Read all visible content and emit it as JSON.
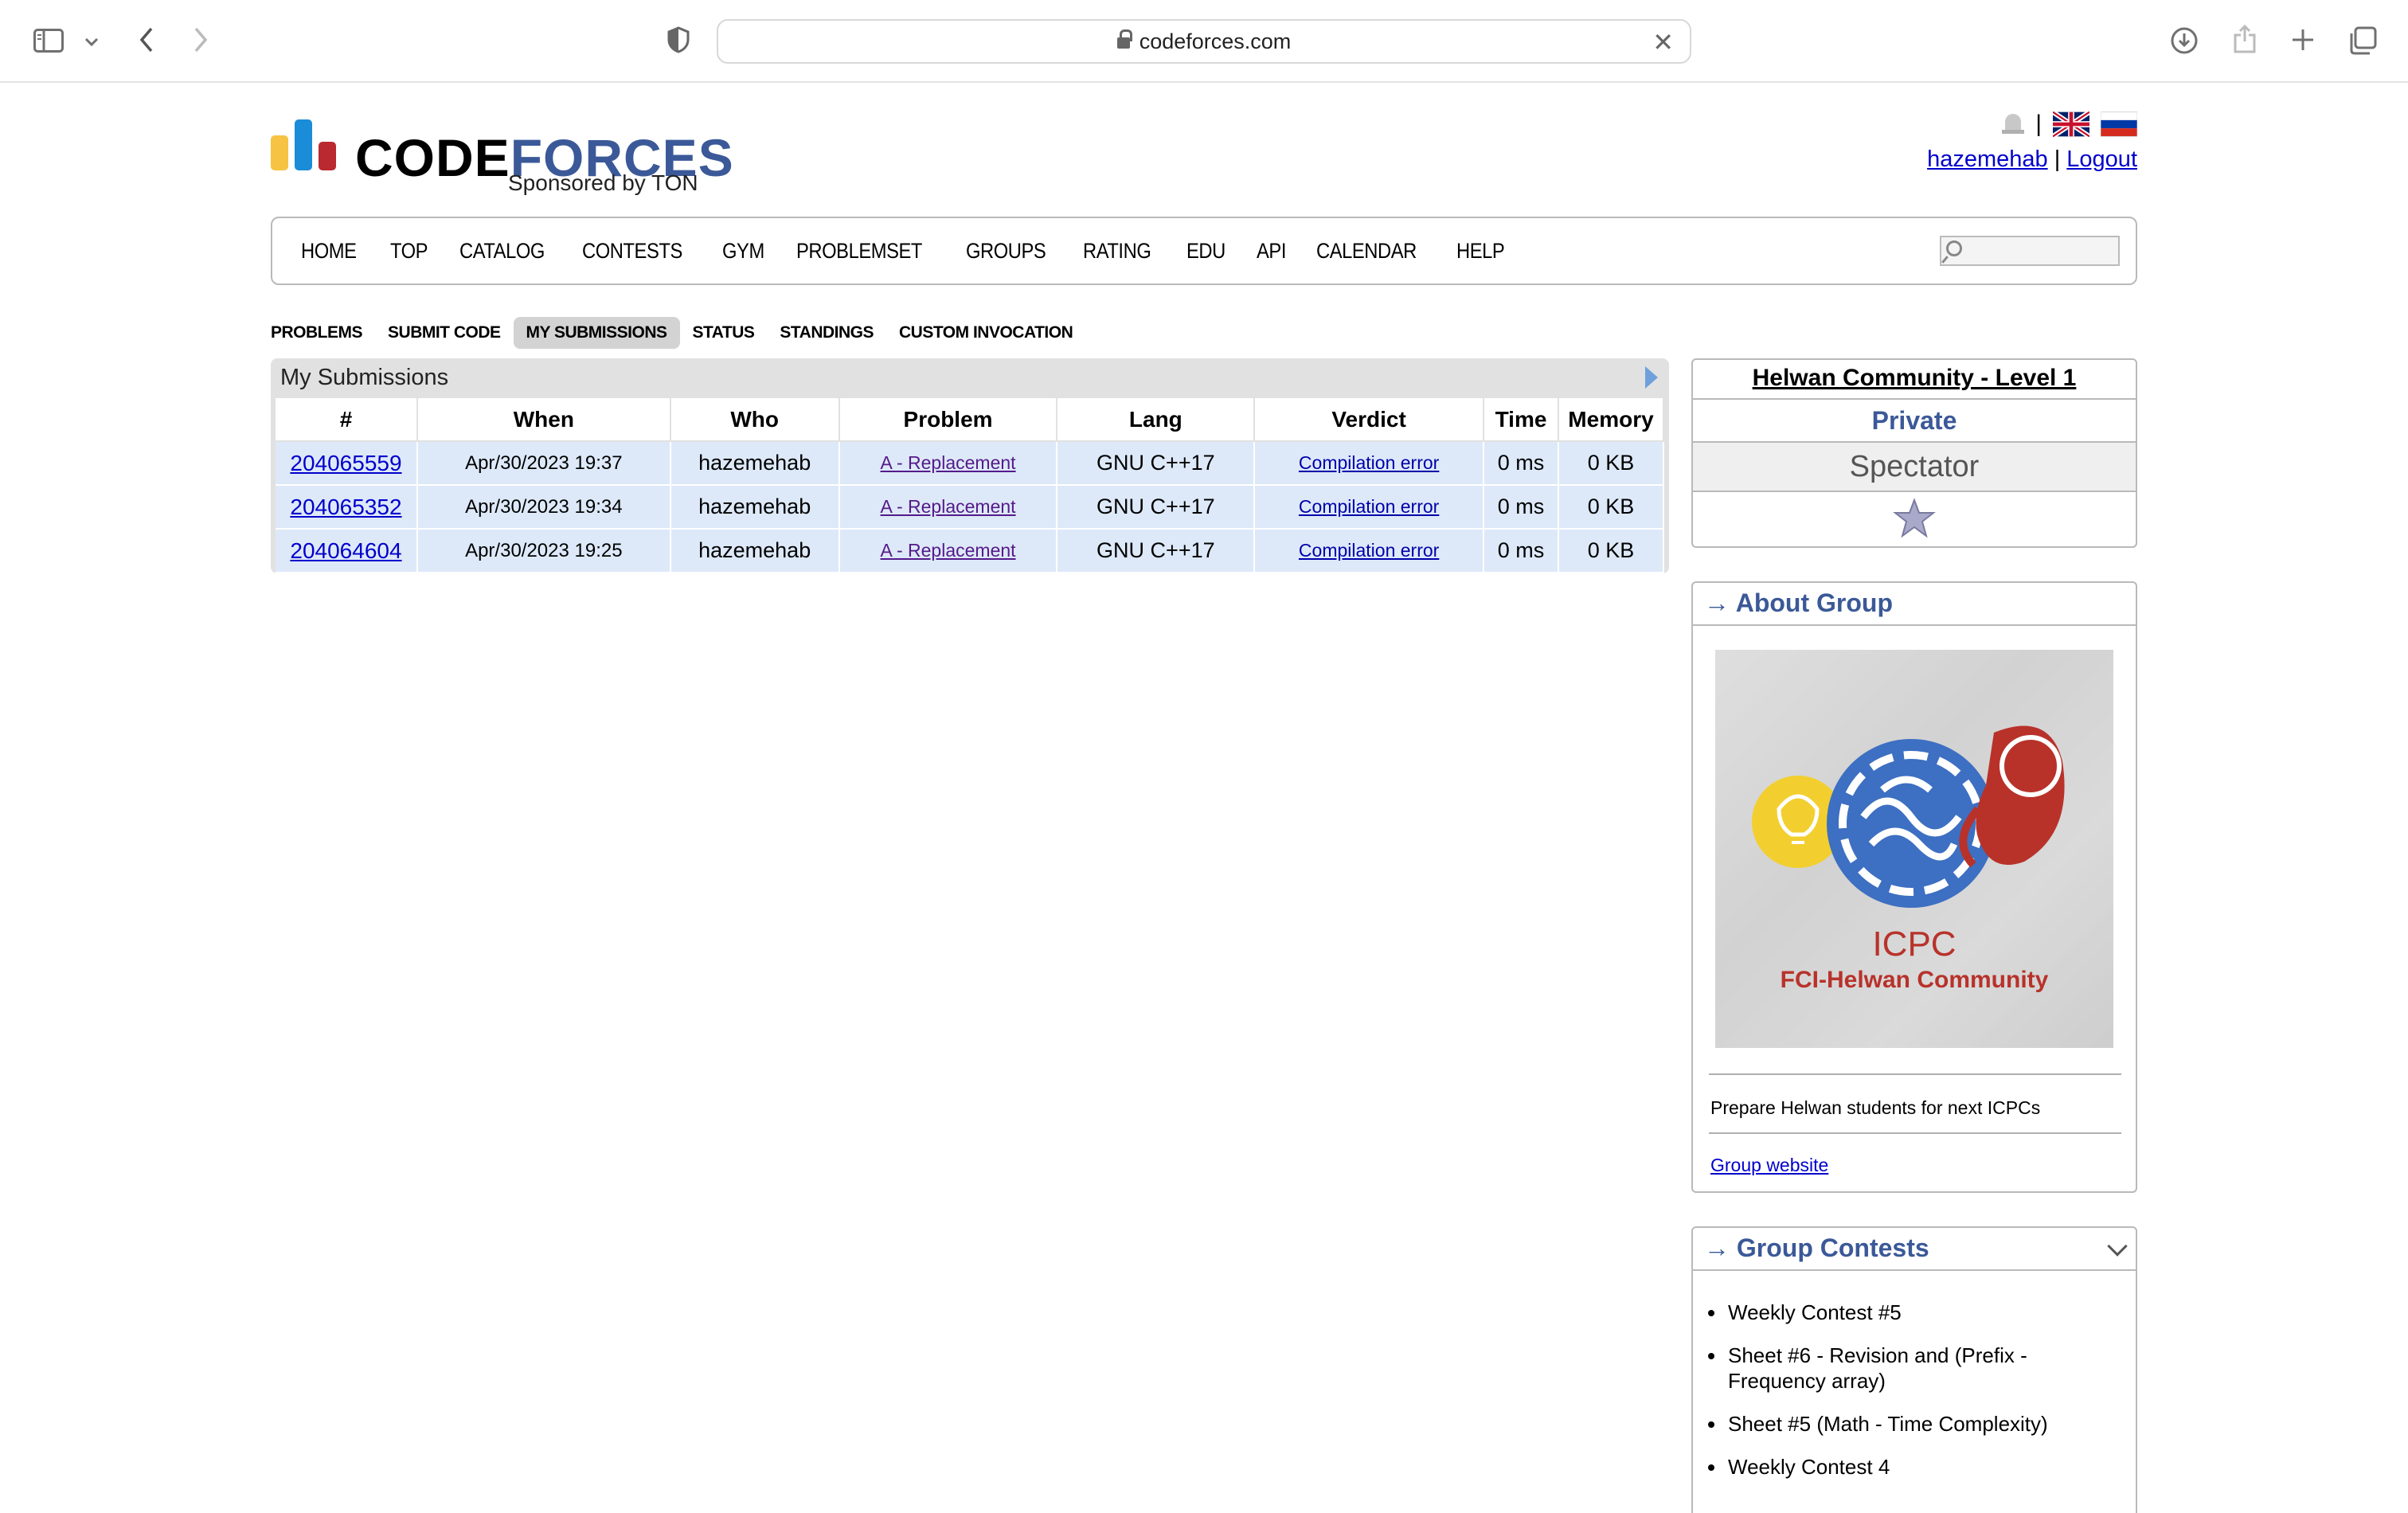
{
  "browser": {
    "url": "codeforces.com"
  },
  "header": {
    "logo_code": "CODE",
    "logo_forces": "FORCES",
    "sponsor": "Sponsored by TON",
    "username": "hazemehab",
    "logout": "Logout",
    "separator": "|"
  },
  "menu": {
    "items": [
      "HOME",
      "TOP",
      "CATALOG",
      "CONTESTS",
      "GYM",
      "PROBLEMSET",
      "GROUPS",
      "RATING",
      "EDU",
      "API",
      "CALENDAR",
      "HELP"
    ]
  },
  "submenu": {
    "items": [
      "PROBLEMS",
      "SUBMIT CODE",
      "MY SUBMISSIONS",
      "STATUS",
      "STANDINGS",
      "CUSTOM INVOCATION"
    ],
    "active": "MY SUBMISSIONS"
  },
  "submissions": {
    "title": "My Submissions",
    "headers": [
      "#",
      "When",
      "Who",
      "Problem",
      "Lang",
      "Verdict",
      "Time",
      "Memory"
    ],
    "rows": [
      {
        "id": "204065559",
        "when": "Apr/30/2023 19:37",
        "who": "hazemehab",
        "problem": "A - Replacement",
        "lang": "GNU C++17",
        "verdict": "Compilation error",
        "time": "0 ms",
        "memory": "0 KB"
      },
      {
        "id": "204065352",
        "when": "Apr/30/2023 19:34",
        "who": "hazemehab",
        "problem": "A - Replacement",
        "lang": "GNU C++17",
        "verdict": "Compilation error",
        "time": "0 ms",
        "memory": "0 KB"
      },
      {
        "id": "204064604",
        "when": "Apr/30/2023 19:25",
        "who": "hazemehab",
        "problem": "A - Replacement",
        "lang": "GNU C++17",
        "verdict": "Compilation error",
        "time": "0 ms",
        "memory": "0 KB"
      }
    ]
  },
  "group": {
    "name": "Helwan Community - Level 1",
    "privacy": "Private",
    "role": "Spectator"
  },
  "about": {
    "caption": "→ About Group",
    "logo_line1": "ICPC",
    "logo_line2": "FCI-Helwan Community",
    "description": "Prepare Helwan students for next ICPCs",
    "website": "Group website"
  },
  "contests": {
    "caption": "→ Group Contests",
    "items": [
      "Weekly Contest #5",
      "Sheet #6 - Revision and (Prefix - Frequency array)",
      "Sheet #5 (Math - Time Complexity)",
      "Weekly Contest 4"
    ]
  },
  "colors": {
    "accent": "#3b5998",
    "link": "#0000cc",
    "row_bg": "#dde9f8"
  }
}
